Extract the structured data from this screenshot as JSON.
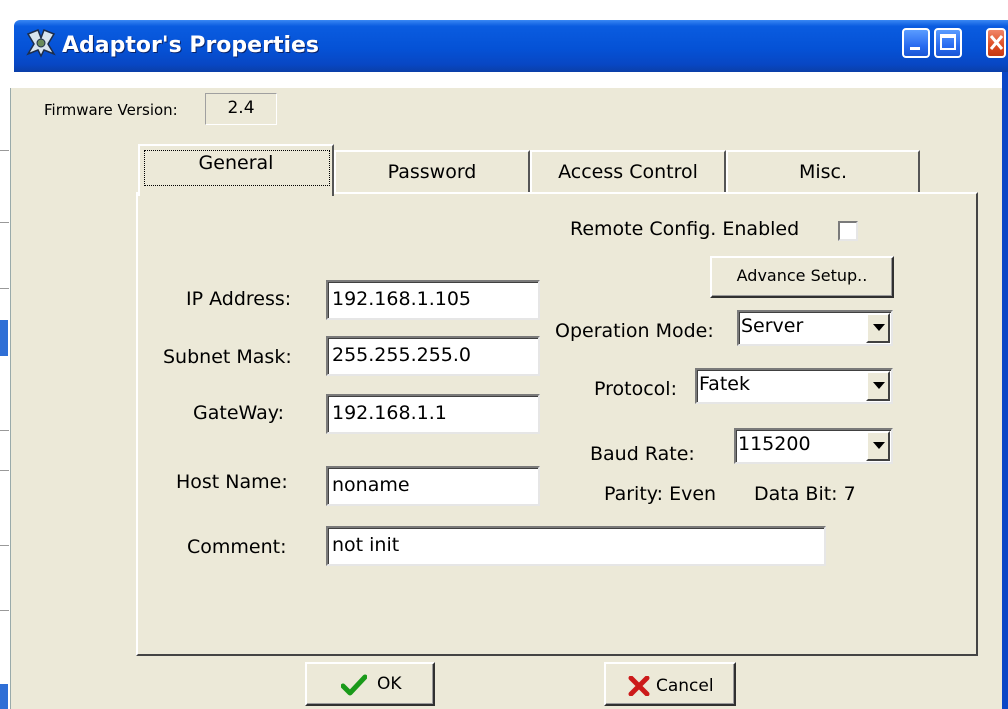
{
  "window": {
    "title": "Adaptor's Properties"
  },
  "firmware": {
    "label": "Firmware Version:",
    "value": "2.4"
  },
  "tabs": [
    {
      "label": "General",
      "active": true
    },
    {
      "label": "Password",
      "active": false
    },
    {
      "label": "Access Control",
      "active": false
    },
    {
      "label": "Misc.",
      "active": false
    }
  ],
  "general": {
    "ip_label": "IP Address:",
    "ip_value": "192.168.1.105",
    "subnet_label": "Subnet Mask:",
    "subnet_value": "255.255.255.0",
    "gateway_label": "GateWay:",
    "gateway_value": "192.168.1.1",
    "host_label": "Host Name:",
    "host_value": "noname",
    "comment_label": "Comment:",
    "comment_value": "not init",
    "remote_label": "Remote Config. Enabled",
    "remote_checked": false,
    "advance_label": "Advance Setup..",
    "opmode_label": "Operation Mode:",
    "opmode_value": "Server",
    "protocol_label": "Protocol:",
    "protocol_value": "Fatek",
    "baud_label": "Baud Rate:",
    "baud_value": "115200",
    "parity_text": "Parity: Even",
    "databit_text": "Data Bit: 7"
  },
  "buttons": {
    "ok_label": "OK",
    "cancel_label": "Cancel"
  },
  "icons": {
    "app": "adaptor-app-icon",
    "minimize": "minimize-icon",
    "maximize": "maximize-icon",
    "close": "close-icon",
    "ok": "checkmark-icon",
    "cancel": "x-cross-icon"
  },
  "colors": {
    "titlebar": "#0552d6",
    "dialog_bg": "#ece9d8",
    "ok_check": "#1a9a1a",
    "cancel_x": "#cc1a1a"
  }
}
